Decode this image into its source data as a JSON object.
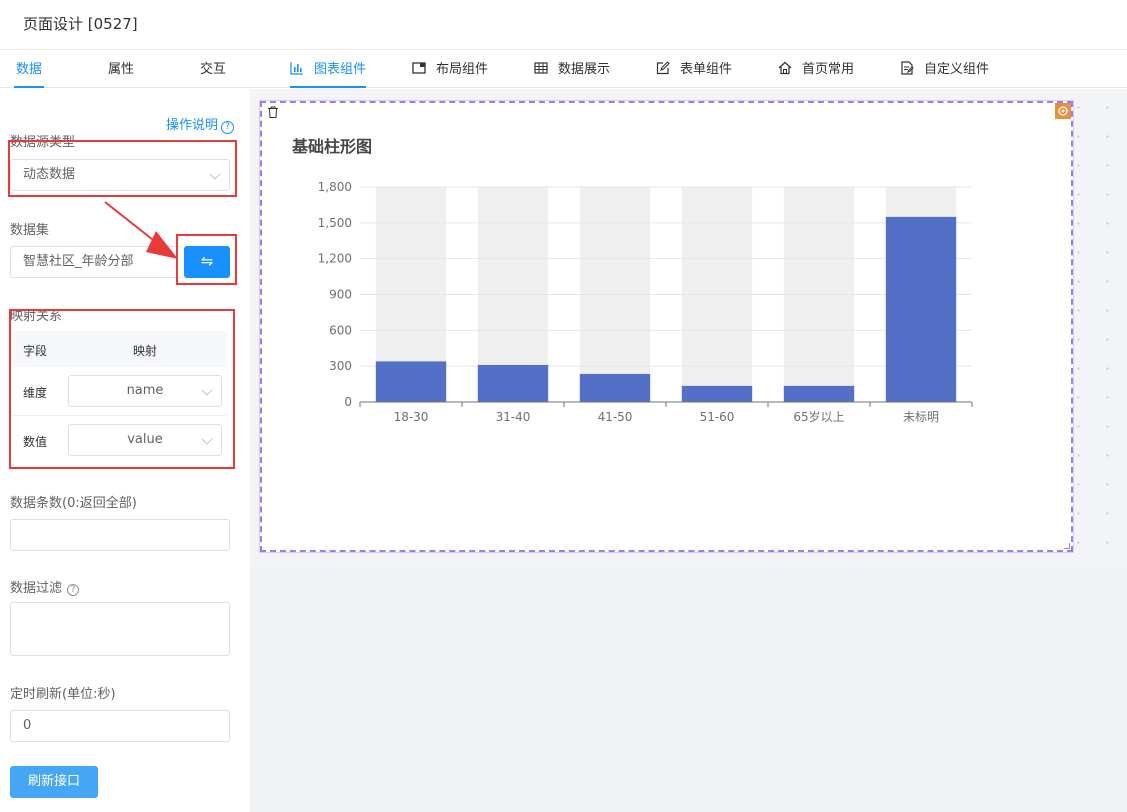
{
  "header": {
    "title": "页面设计 [0527]"
  },
  "left_tabs": [
    "数据",
    "属性",
    "交互"
  ],
  "component_tabs": [
    {
      "label": "图表组件",
      "icon": "bar-chart-icon"
    },
    {
      "label": "布局组件",
      "icon": "layout-icon"
    },
    {
      "label": "数据展示",
      "icon": "table-icon"
    },
    {
      "label": "表单组件",
      "icon": "edit-icon"
    },
    {
      "label": "首页常用",
      "icon": "home-icon"
    },
    {
      "label": "自定义组件",
      "icon": "custom-doc-icon"
    }
  ],
  "panel": {
    "help_label": "操作说明",
    "datasource_type_label": "数据源类型",
    "datasource_type_value": "动态数据",
    "dataset_label": "数据集",
    "dataset_value": "智慧社区_年龄分部",
    "swap_icon": "⇋",
    "mapping_label": "映射关系",
    "mapping_header": {
      "field": "字段",
      "map": "映射"
    },
    "mapping_rows": [
      {
        "field": "维度",
        "value": "name"
      },
      {
        "field": "数值",
        "value": "value"
      }
    ],
    "count_label": "数据条数(0:返回全部)",
    "count_value": "",
    "filter_label": "数据过滤",
    "refresh_label": "定时刷新(单位:秒)",
    "refresh_value": "0",
    "refresh_button": "刷新接口"
  },
  "colors": {
    "accent": "#1890ff",
    "bar": "#5470c6",
    "bar_bg": "#efefef",
    "highlight": "#e83a3a"
  },
  "chart_data": {
    "type": "bar",
    "title": "基础柱形图",
    "categories": [
      "18-30",
      "31-40",
      "41-50",
      "51-60",
      "65岁以上",
      "未标明"
    ],
    "values": [
      340,
      310,
      235,
      135,
      135,
      1550
    ],
    "ylim": [
      0,
      1800
    ],
    "yticks": [
      "0",
      "300",
      "600",
      "900",
      "1,200",
      "1,500",
      "1,800"
    ],
    "background_bars": true,
    "grid": true
  }
}
